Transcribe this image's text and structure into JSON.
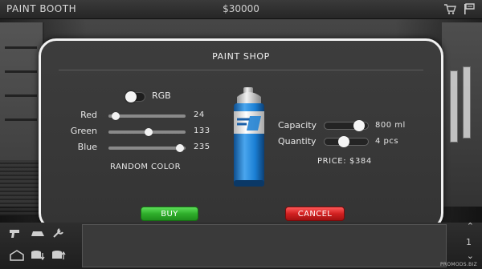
{
  "topbar": {
    "title": "PAINT BOOTH",
    "money": "$30000",
    "icons": [
      "cart-icon",
      "flag-icon"
    ]
  },
  "shop": {
    "title": "PAINT SHOP",
    "rgb_label": "RGB",
    "channels": [
      {
        "label": "Red",
        "value": "24",
        "fraction": 0.094
      },
      {
        "label": "Green",
        "value": "133",
        "fraction": 0.522
      },
      {
        "label": "Blue",
        "value": "235",
        "fraction": 0.922
      }
    ],
    "random_label": "RANDOM COLOR",
    "capacity": {
      "label": "Capacity",
      "value": "800 ml",
      "fraction": 0.8
    },
    "quantity": {
      "label": "Quantity",
      "value": "4 pcs",
      "fraction": 0.45
    },
    "price": "PRICE: $384",
    "buy_label": "BUY",
    "cancel_label": "CANCEL"
  },
  "bottom": {
    "page": "1",
    "watermark": "PROMODS.BIZ"
  },
  "colors": {
    "accent_green": "#2fae2b",
    "accent_red": "#d12020",
    "paint_blue": "#1a7fd4"
  }
}
